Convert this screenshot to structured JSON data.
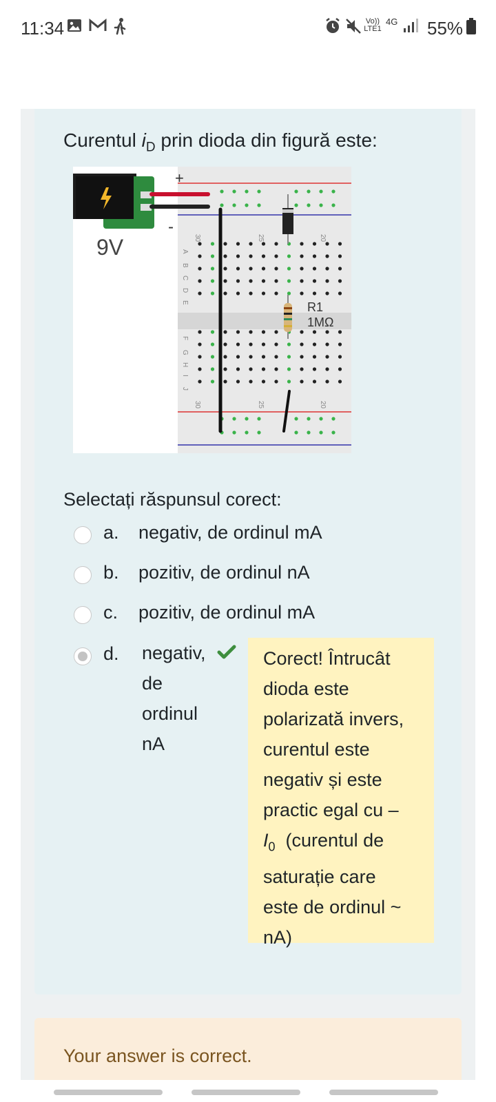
{
  "status_bar": {
    "time": "11:34",
    "network": "4G",
    "network_sub": "LTE1",
    "volte": "Vo))",
    "battery_percent": "55%",
    "icons": [
      "gallery-icon",
      "gmail-icon",
      "walking-icon",
      "alarm-icon",
      "mute-icon",
      "volte-icon",
      "signal-icon",
      "battery-icon"
    ]
  },
  "question": {
    "text_before": "Curentul ",
    "symbol": "i",
    "subscript": "D",
    "text_after": " prin dioda din figură este:"
  },
  "figure": {
    "plus_sign": "+",
    "minus_sign": "-",
    "battery_label": "9V",
    "resistor_name": "R1",
    "resistor_value": "1MΩ",
    "column_numbers": [
      "30",
      "25",
      "20"
    ],
    "row_letters_top": [
      "A",
      "B",
      "C",
      "D",
      "E"
    ],
    "row_letters_bottom": [
      "F",
      "G",
      "H",
      "I",
      "J"
    ]
  },
  "prompt": "Selectați răspunsul corect:",
  "options": [
    {
      "letter": "a.",
      "text": "negativ, de ordinul mA",
      "selected": false
    },
    {
      "letter": "b.",
      "text": "pozitiv, de ordinul nA",
      "selected": false
    },
    {
      "letter": "c.",
      "text": "pozitiv, de ordinul mA",
      "selected": false
    },
    {
      "letter": "d.",
      "text": "negativ, de ordinul nA",
      "selected": true,
      "lines": [
        "negativ,",
        "de",
        "ordinul",
        "nA"
      ]
    }
  ],
  "feedback": {
    "line1": "Corect! Întrucât",
    "line2": "dioda este",
    "line3": "polarizată invers,",
    "line4": "curentul este",
    "line5": "negativ și este",
    "line6": "practic egal cu –",
    "symbol": "I",
    "subscript": "0",
    "line7_rest": "(curentul de",
    "line8": "saturație care",
    "line9": "este de ordinul ~",
    "line10": "nA)"
  },
  "result": "Your answer is correct.",
  "colors": {
    "card": "#e6f1f3",
    "feedback": "#fff3c0",
    "result_bg": "#fbeddb",
    "result_text": "#7a5520",
    "check": "#3e8e3e"
  }
}
